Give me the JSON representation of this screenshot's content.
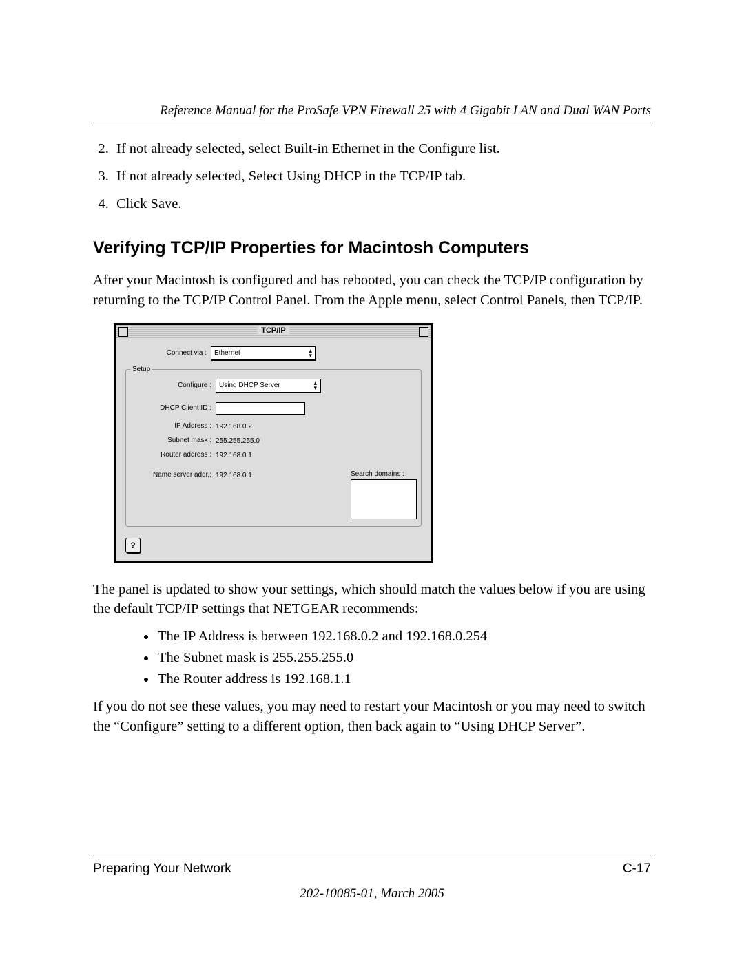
{
  "header": {
    "title": "Reference Manual for the ProSafe VPN Firewall 25 with 4 Gigabit LAN and Dual WAN Ports"
  },
  "steps": {
    "s2": "If not already selected, select Built-in Ethernet in the Configure list.",
    "s3": "If not already selected, Select Using DHCP in the TCP/IP tab.",
    "s4": "Click Save."
  },
  "section_heading": "Verifying TCP/IP Properties for Macintosh Computers",
  "intro_para": "After your Macintosh is configured and has rebooted, you can check the TCP/IP configuration by returning to the TCP/IP Control Panel. From the Apple menu, select Control Panels, then TCP/IP.",
  "tcpip": {
    "window_title": "TCP/IP",
    "connect_via_label": "Connect via :",
    "connect_via_value": "Ethernet",
    "setup_legend": "Setup",
    "configure_label": "Configure :",
    "configure_value": "Using DHCP Server",
    "dhcp_client_label": "DHCP Client ID :",
    "ip_address_label": "IP Address :",
    "ip_address_value": "192.168.0.2",
    "subnet_label": "Subnet mask :",
    "subnet_value": "255.255.255.0",
    "router_label": "Router address :",
    "router_value": "192.168.0.1",
    "nameserver_label": "Name server addr.:",
    "nameserver_value": "192.168.0.1",
    "search_domains_label": "Search domains :",
    "help_glyph": "?"
  },
  "post_para": "The panel is updated to show your settings, which should match the values below if you are using the default TCP/IP settings that NETGEAR recommends:",
  "bullets": {
    "b1": "The IP Address is between 192.168.0.2 and 192.168.0.254",
    "b2": "The Subnet mask is 255.255.255.0",
    "b3": "The Router address is 192.168.1.1"
  },
  "closing_para": "If you do not see these values, you may need to restart your Macintosh or you may need to switch the “Configure” setting to a different option, then back again to “Using DHCP Server”.",
  "footer": {
    "section_name": "Preparing Your Network",
    "page_number": "C-17",
    "doc_id": "202-10085-01, March 2005"
  }
}
